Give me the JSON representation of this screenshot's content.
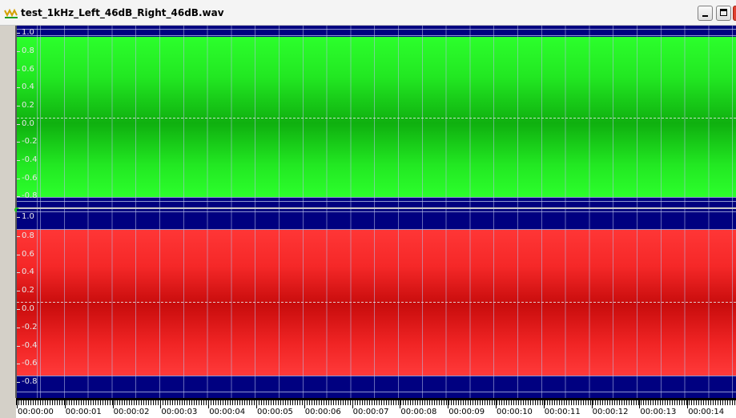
{
  "window": {
    "title": "test_1kHz_Left_46dB_Right_46dB.wav",
    "icon": "waveform-icon",
    "buttons": [
      "minimize",
      "maximize",
      "close"
    ]
  },
  "channels": [
    {
      "name": "left",
      "color": "#22e822",
      "y_labels": [
        "1.0",
        "0.8",
        "0.6",
        "0.4",
        "0.2",
        "0.0",
        "-0.2",
        "-0.4",
        "-0.6",
        "-0.8"
      ]
    },
    {
      "name": "right",
      "color": "#f02424",
      "y_labels": [
        "1.0",
        "0.8",
        "0.6",
        "0.4",
        "0.2",
        "0.0",
        "-0.2",
        "-0.4",
        "-0.6",
        "-0.8"
      ]
    }
  ],
  "colors": {
    "background": "#000080",
    "grid": "#b4bee6",
    "left_fill": "#22e822",
    "right_fill": "#f02424"
  },
  "timeline": {
    "labels": [
      "00:00:00",
      "00:00:01",
      "00:00:02",
      "00:00:03",
      "00:00:04",
      "00:00:05",
      "00:00:06",
      "00:00:07",
      "00:00:08",
      "00:00:09",
      "00:00:10",
      "00:00:11",
      "00:00:12",
      "00:00:13",
      "00:00:14"
    ]
  }
}
